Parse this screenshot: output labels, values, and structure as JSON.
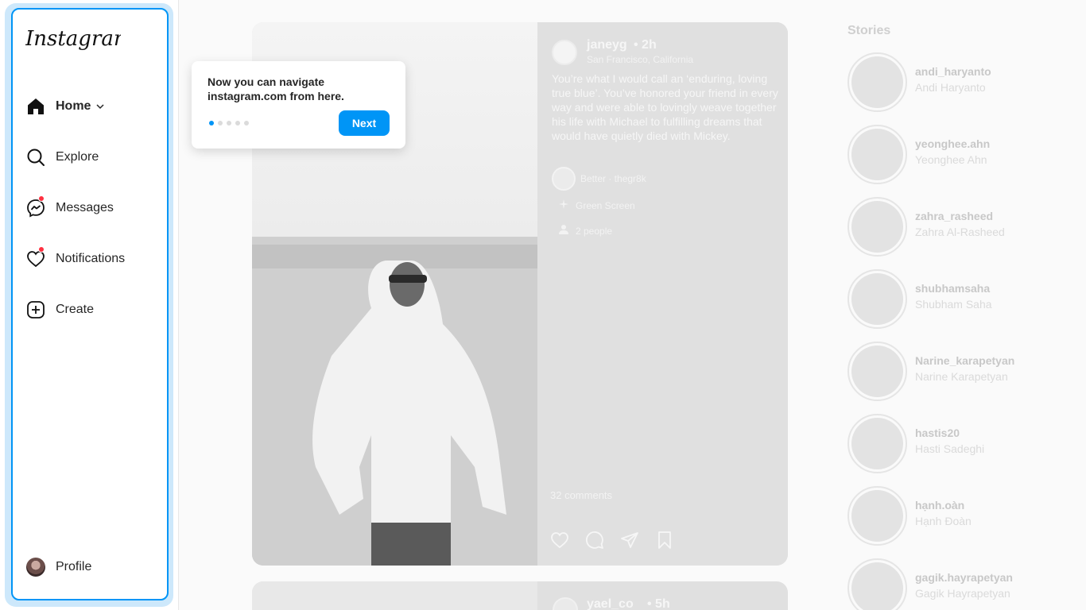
{
  "app": {
    "logo_text": "Instagram"
  },
  "nav": {
    "home": "Home",
    "explore": "Explore",
    "messages": "Messages",
    "notifications": "Notifications",
    "create": "Create",
    "profile": "Profile"
  },
  "tooltip": {
    "text": "Now you can navigate instagram.com from here.",
    "next": "Next",
    "steps_total": 5,
    "step_current": 1
  },
  "post": {
    "username": "janeyg",
    "time": "• 2h",
    "location": "San Francisco, California",
    "caption": "You’re what I would call an ‘enduring, loving true blue’. You’ve honored your friend in every way and were able to lovingly weave together his life with Michael to fulfilling dreams that would have quietly died with Mickey.",
    "music": "Better · thegr8k",
    "effect": "Green Screen",
    "tagged": "2 people",
    "comments": "32 comments"
  },
  "post2": {
    "username": "yael_co",
    "time": "• 5h"
  },
  "stories": {
    "title": "Stories",
    "items": [
      {
        "username": "andi_haryanto",
        "name": "Andi Haryanto"
      },
      {
        "username": "yeonghee.ahn",
        "name": "Yeonghee Ahn"
      },
      {
        "username": "zahra_rasheed",
        "name": "Zahra Al-Rasheed"
      },
      {
        "username": "shubhamsaha",
        "name": "Shubham Saha"
      },
      {
        "username": "Narine_karapetyan",
        "name": "Narine Karapetyan"
      },
      {
        "username": "hastis20",
        "name": "Hasti Sadeghi"
      },
      {
        "username": "hạnh.oàn",
        "name": "Hạnh Đoàn"
      },
      {
        "username": "gagik.hayrapetyan",
        "name": "Gagik Hayrapetyan"
      }
    ]
  },
  "colors": {
    "accent": "#0095f6",
    "notification_dot": "#ff3040"
  }
}
